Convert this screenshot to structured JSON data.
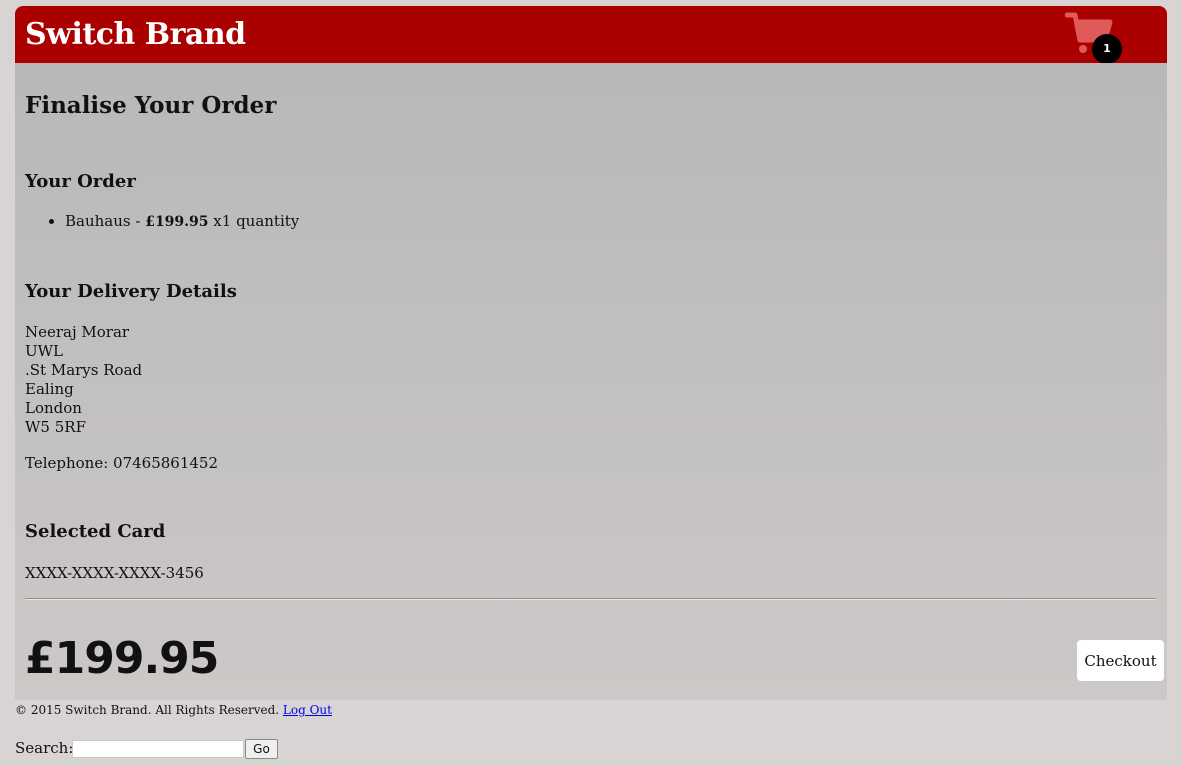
{
  "header": {
    "brand": "Switch Brand",
    "cart_count": "1"
  },
  "page": {
    "title": "Finalise Your Order"
  },
  "order": {
    "heading": "Your Order",
    "items": [
      {
        "name": "Bauhaus",
        "separator": " - ",
        "price": "£199.95",
        "quantity_text": " x1 quantity"
      }
    ]
  },
  "delivery": {
    "heading": "Your Delivery Details",
    "lines": [
      "Neeraj Morar",
      "UWL",
      ".St Marys Road",
      "Ealing",
      "London",
      "W5 5RF"
    ],
    "telephone": "Telephone: 07465861452"
  },
  "card": {
    "heading": "Selected Card",
    "number": "XXXX-XXXX-XXXX-3456"
  },
  "summary": {
    "total": "£199.95",
    "checkout_label": "Checkout"
  },
  "footer": {
    "copyright": "© 2015 Switch Brand. All Rights Reserved.",
    "logout_label": "Log Out"
  },
  "search": {
    "label": "Search:",
    "value": "",
    "go_label": "Go"
  },
  "colors": {
    "header_bg": "#aa0000",
    "cart_icon": "#e05a5a",
    "page_bg": "#d8d4d3"
  },
  "icons": {
    "cart": "shopping-cart-icon"
  }
}
